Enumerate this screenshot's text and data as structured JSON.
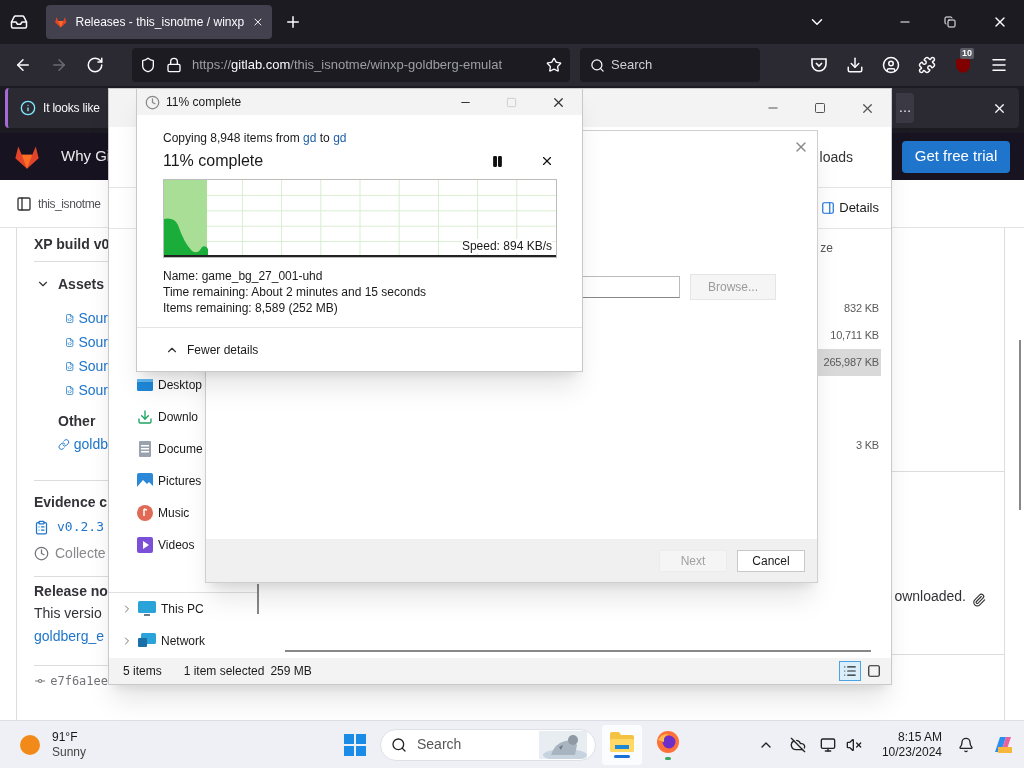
{
  "browser": {
    "tabs": [
      {
        "title": "Releases - this_isnotme / winxp",
        "selected": true
      }
    ],
    "nav": [
      {
        "kind": "back",
        "disabled": false
      },
      {
        "kind": "forward",
        "disabled": true
      },
      {
        "kind": "reload",
        "disabled": false
      }
    ],
    "url": {
      "scheme": "https://",
      "host": "gitlab.com",
      "path": "/this_isnotme/winxp-goldberg-emulat"
    },
    "search_placeholder": "Search",
    "extension_badge": "10"
  },
  "infobar": {
    "message": "It looks like",
    "button": "…"
  },
  "gitlab": {
    "nav_link": "Why Gi",
    "cta": "Get free trial",
    "breadcrumb": "this_isnotme",
    "release_title": "XP build v0",
    "assets": {
      "heading": "Assets",
      "expanded": true,
      "sources": [
        "Sour",
        "Sour",
        "Sour",
        "Sour"
      ],
      "other_heading": "Other",
      "other_link": "goldb"
    },
    "evidence": {
      "heading": "Evidence c",
      "tag": "v0.2.3",
      "collected": "Collecte"
    },
    "notes": {
      "heading": "Release no",
      "text": "This versio",
      "link": "goldberg_e",
      "text_end": "ownloaded."
    },
    "commit": "e7f6a1ee"
  },
  "explorer": {
    "crumb": "loads",
    "details": "Details",
    "column": "ze",
    "files": [
      {
        "size": "832 KB",
        "selected": false
      },
      {
        "size": "10,711 KB",
        "selected": false
      },
      {
        "size": "265,987 KB",
        "selected": true
      },
      {
        "size": "3 KB",
        "selected": false
      }
    ],
    "nav": [
      {
        "label": "Desktop",
        "kind": "desktop"
      },
      {
        "label": "Downlo",
        "kind": "downloads"
      },
      {
        "label": "Docume",
        "kind": "documents"
      },
      {
        "label": "Pictures",
        "kind": "pictures"
      },
      {
        "label": "Music",
        "kind": "music"
      },
      {
        "label": "Videos",
        "kind": "videos"
      }
    ],
    "roots": [
      {
        "label": "This PC",
        "kind": "pc",
        "expanded": false
      },
      {
        "label": "Network",
        "kind": "network",
        "expanded": false
      }
    ],
    "status": {
      "count": "5 items",
      "selection": "1 item selected",
      "size": "259 MB"
    },
    "views": [
      {
        "kind": "details",
        "selected": true
      },
      {
        "kind": "tiles",
        "selected": false
      }
    ]
  },
  "wizard": {
    "browse": {
      "label": "Browse...",
      "disabled": true
    },
    "buttons": [
      {
        "label": "Next",
        "disabled": true
      },
      {
        "label": "Cancel",
        "disabled": false
      }
    ]
  },
  "copy": {
    "title": "11% complete",
    "copying": "Copying 8,948 items from",
    "source": "gd",
    "to": "to",
    "dest": "gd",
    "heading": "11% complete",
    "level": 0.11,
    "speed": "Speed: 894 KB/s",
    "details": [
      {
        "label": "Name:",
        "value": "game_bg_27_001-uhd"
      },
      {
        "label": "Time remaining:",
        "value": "About 2 minutes and 15 seconds"
      },
      {
        "label": "Items remaining:",
        "value": "8,589 (252 MB)"
      }
    ],
    "toggle": "Fewer details",
    "expanded": true
  },
  "taskbar": {
    "weather": {
      "temp": "91°F",
      "condition": "Sunny"
    },
    "search": "Search",
    "apps": [
      {
        "kind": "explorer",
        "active": true
      },
      {
        "kind": "firefox",
        "active": false
      }
    ],
    "time": "8:15 AM",
    "date": "10/23/2024"
  }
}
